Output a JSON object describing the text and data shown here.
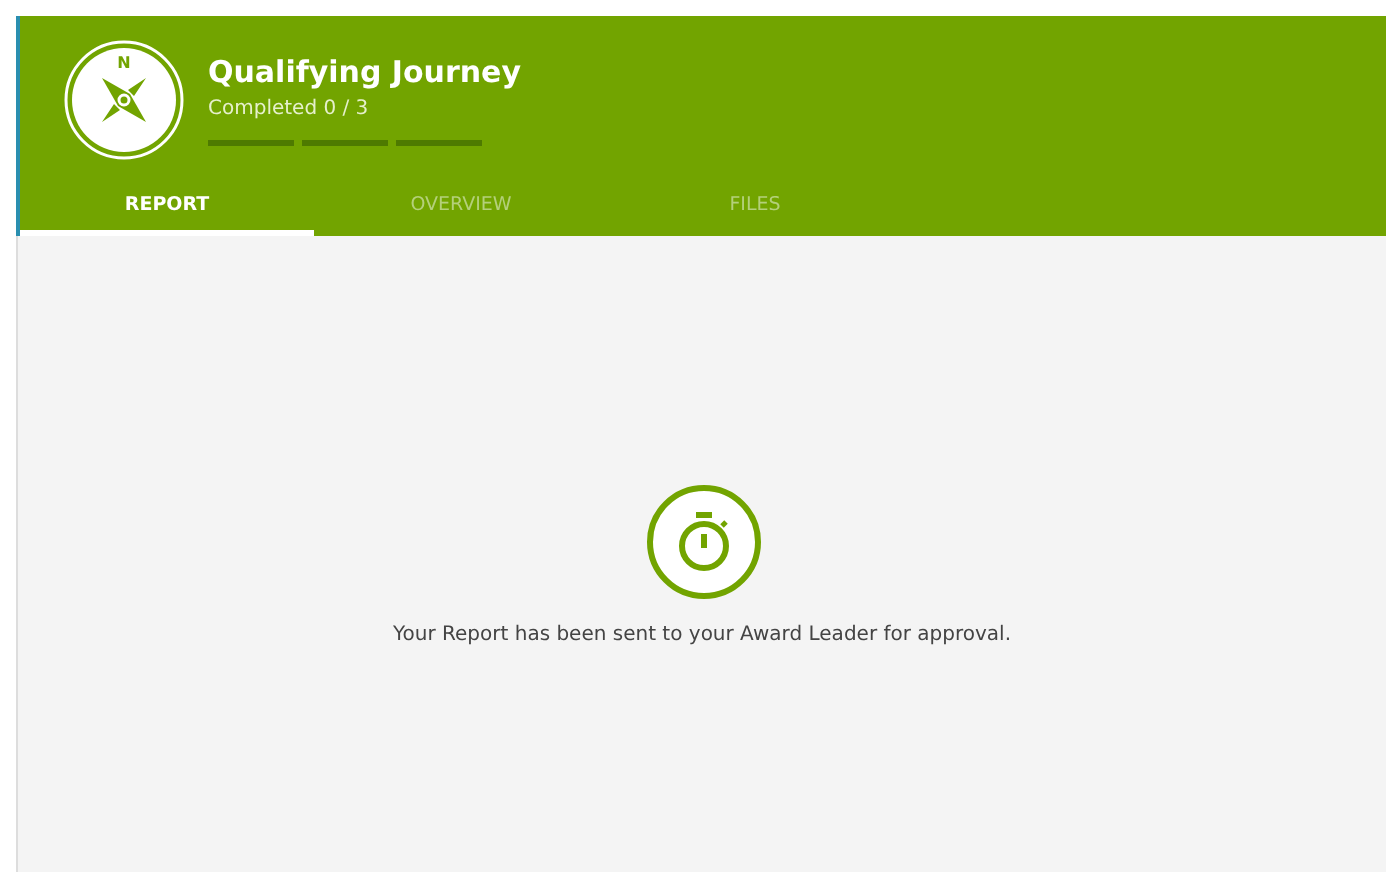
{
  "header": {
    "badge_letter": "N",
    "title": "Qualifying Journey",
    "subtitle": "Completed 0 / 3",
    "steps": [
      {
        "done": false
      },
      {
        "done": false
      },
      {
        "done": false
      }
    ]
  },
  "tabs": [
    {
      "label": "REPORT",
      "selected": true
    },
    {
      "label": "OVERVIEW",
      "selected": false
    },
    {
      "label": "FILES",
      "selected": false
    }
  ],
  "message": "Your Report has been sent to your Award Leader for approval."
}
